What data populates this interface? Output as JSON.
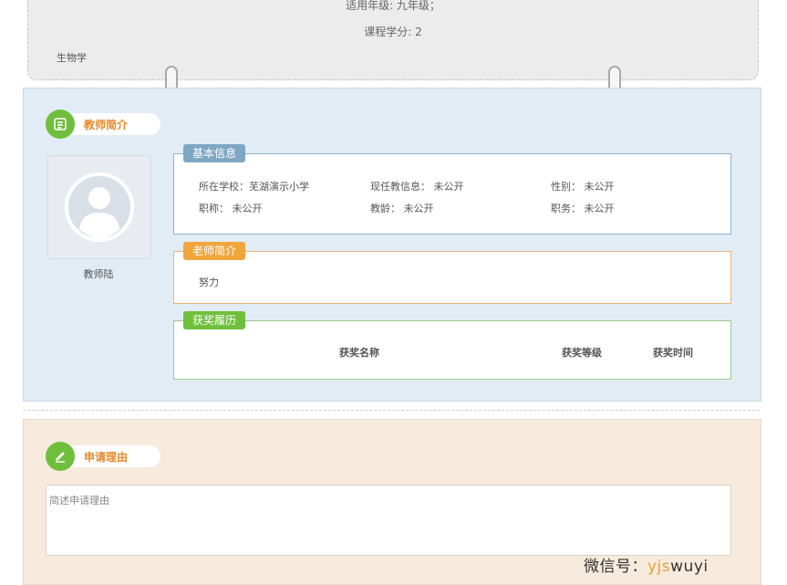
{
  "course": {
    "grade_line": "适用年级: 九年级；",
    "credit_line": "课程学分: 2",
    "subject": "生物学"
  },
  "teacher_section": {
    "title": "教师简介",
    "teacher_name": "教师陆",
    "basic_info": {
      "tab": "基本信息",
      "school": "所在学校：芜湖演示小学",
      "current_info": "现任教信息： 未公开",
      "gender": "性别： 未公开",
      "title": "职称： 未公开",
      "teaching_age": "教龄： 未公开",
      "position": "职务： 未公开"
    },
    "intro": {
      "tab": "老师简介",
      "text": "努力"
    },
    "awards": {
      "tab": "获奖履历",
      "columns": [
        "获奖名称",
        "获奖等级",
        "获奖时间"
      ]
    }
  },
  "apply_section": {
    "title": "申请理由",
    "placeholder": "简述申请理由"
  },
  "watermark": {
    "prefix": "微信号：",
    "accent": "yjs",
    "suffix": "wuyi"
  },
  "colors": {
    "accent_green": "#6fbf3d",
    "title_orange": "#e58a2b",
    "tab_blue": "#7ea7c4",
    "tab_orange": "#f0a63c",
    "tab_green": "#6fbf3d",
    "teacher_bg": "#e1ecf5",
    "apply_bg": "#f7ebdd"
  },
  "icons": [
    "list-icon",
    "user-avatar-icon",
    "pencil-icon"
  ]
}
